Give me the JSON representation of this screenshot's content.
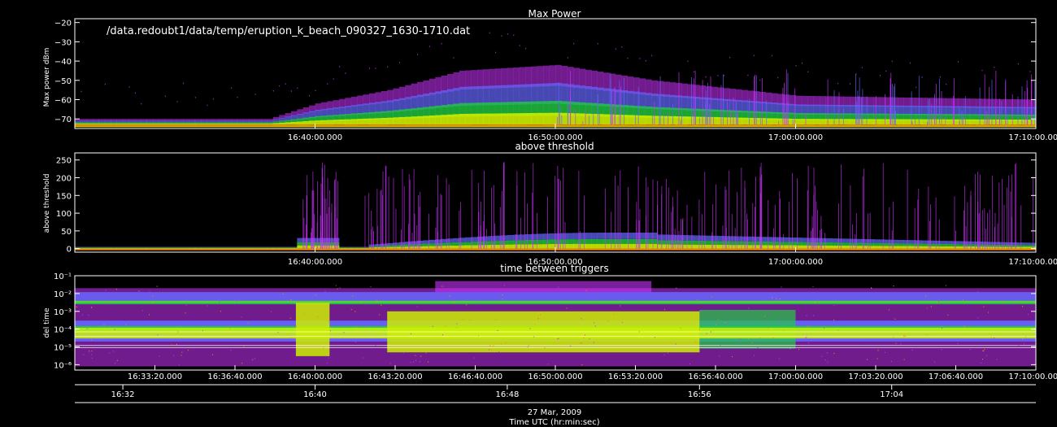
{
  "file_path": "/data.redoubt1/data/temp/eruption_k_beach_090327_1630-1710.dat",
  "footer": {
    "date": "27 Mar, 2009",
    "xlabel": "Time UTC (hr:min:sec)"
  },
  "colors": {
    "background": "#000000",
    "axes": "#ffffff",
    "magenta": "#cc33ff",
    "blue": "#6666ff",
    "green": "#22cc44",
    "yellow": "#ccee00",
    "orange": "#ff8800",
    "white": "#ffffff"
  },
  "chart_data": [
    {
      "type": "scatter",
      "title": "Max Power",
      "ylabel": "Max power dBm",
      "ylim": [
        -75,
        -18
      ],
      "y_ticks": [
        -70,
        -60,
        -50,
        -40,
        -30,
        -20
      ],
      "y_tick_labels": [
        "−70",
        "−60",
        "−50",
        "−40",
        "−30",
        "−20"
      ],
      "xlim": [
        "16:30:00",
        "17:10:00"
      ],
      "x_tick_labels": [
        "16:40:00.000",
        "16:50:00.000",
        "17:00:00.000",
        "17:10:00.000"
      ],
      "envelope": {
        "description_time": [
          "16:30",
          "16:38",
          "16:40",
          "16:43",
          "16:46",
          "16:50",
          "16:54",
          "17:00",
          "17:10"
        ],
        "upper_dBm": [
          -70,
          -70,
          -62,
          -55,
          -45,
          -42,
          -50,
          -58,
          -60
        ]
      }
    },
    {
      "type": "scatter",
      "title": "above threshold",
      "ylabel": "above threshold",
      "ylim": [
        -10,
        270
      ],
      "y_ticks": [
        0,
        50,
        100,
        150,
        200,
        250
      ],
      "y_tick_labels": [
        "0",
        "50",
        "100",
        "150",
        "200",
        "250"
      ],
      "xlim": [
        "16:30:00",
        "17:10:00"
      ],
      "x_tick_labels": [
        "16:40:00.000",
        "16:50:00.000",
        "17:00:00.000",
        "17:10:00.000"
      ]
    },
    {
      "type": "scatter",
      "title": "time between triggers",
      "ylabel": "del time",
      "yscale": "log",
      "ylim": [
        5e-07,
        0.1
      ],
      "y_ticks": [
        0.1,
        0.01,
        0.001,
        0.0001,
        1e-05,
        1e-06
      ],
      "y_tick_labels": [
        "10⁻¹",
        "10⁻²",
        "10⁻³",
        "10⁻⁴",
        "10⁻⁵",
        "10⁻⁶"
      ],
      "xlim": [
        "16:30:00",
        "17:10:00"
      ],
      "x_tick_labels": [
        "16:33:20.000",
        "16:36:40.000",
        "16:40:00.000",
        "16:43:20.000",
        "16:46:40.000",
        "16:50:00.000",
        "16:53:20.000",
        "16:56:40.000",
        "17:00:00.000",
        "17:03:20.000",
        "17:06:40.000",
        "17:10:00.000"
      ]
    },
    {
      "type": "axis",
      "xlim": [
        "16:30:00",
        "17:10:00"
      ],
      "x_tick_labels": [
        "16:32",
        "16:40",
        "16:48",
        "16:56",
        "17:04"
      ]
    }
  ]
}
